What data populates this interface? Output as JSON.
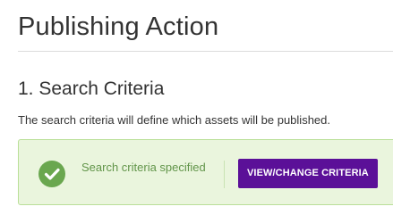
{
  "page": {
    "title": "Publishing Action"
  },
  "section": {
    "title": "1. Search Criteria",
    "description": "The search criteria will define which assets will be published."
  },
  "status": {
    "text": "Search criteria specified",
    "icon": "check-circle-icon",
    "state": "complete"
  },
  "actions": {
    "change_criteria_label": "VIEW/CHANGE CRITERIA"
  },
  "colors": {
    "accent": "#5b1098",
    "success_bg": "#eaf5dd",
    "success_border": "#b9df98",
    "success_icon": "#6aa74f",
    "success_text": "#62954a"
  }
}
